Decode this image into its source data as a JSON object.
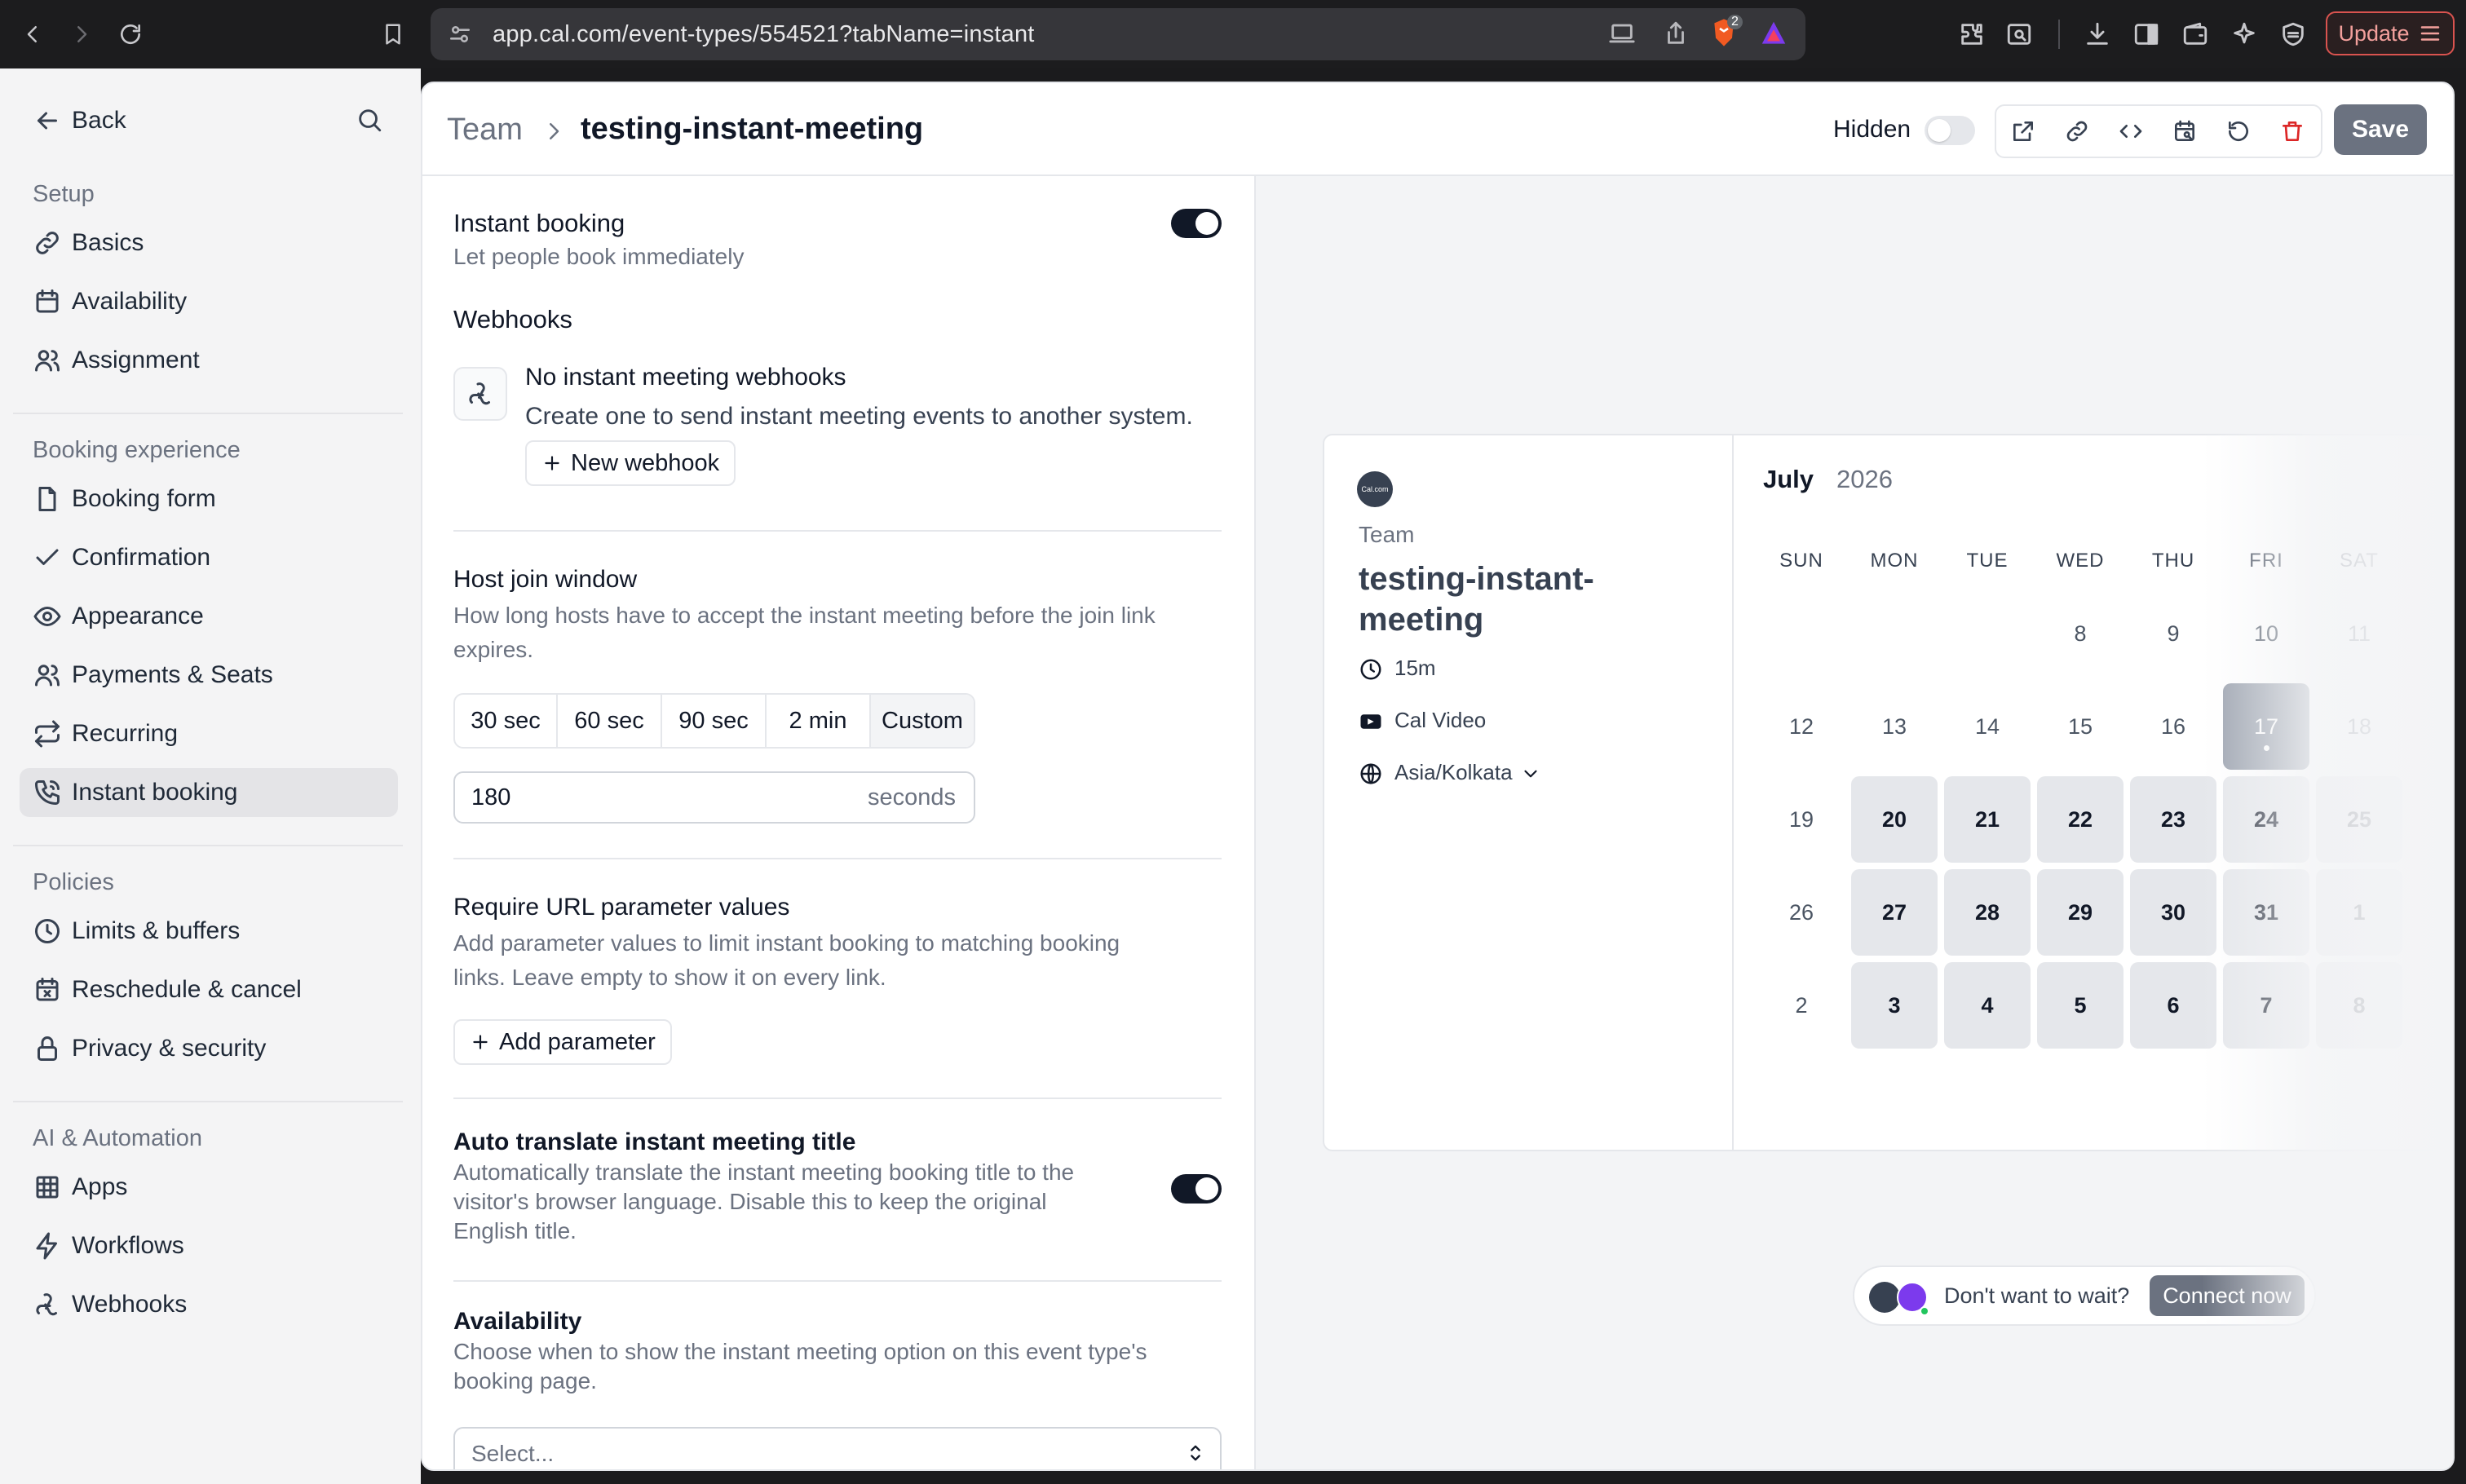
{
  "browser": {
    "url": "app.cal.com/event-types/554521?tabName=instant",
    "shield_badge": "2",
    "update_label": "Update"
  },
  "sidebar": {
    "back_label": "Back",
    "sections": [
      {
        "heading": "Setup",
        "items": [
          "Basics",
          "Availability",
          "Assignment"
        ]
      },
      {
        "heading": "Booking experience",
        "items": [
          "Booking form",
          "Confirmation",
          "Appearance",
          "Payments & Seats",
          "Recurring",
          "Instant booking"
        ]
      },
      {
        "heading": "Policies",
        "items": [
          "Limits & buffers",
          "Reschedule & cancel",
          "Privacy & security"
        ]
      },
      {
        "heading": "AI & Automation",
        "items": [
          "Apps",
          "Workflows",
          "Webhooks"
        ]
      }
    ],
    "active_item": "Instant booking"
  },
  "header": {
    "breadcrumb_team": "Team",
    "title": "testing-instant-meeting",
    "hidden_label": "Hidden",
    "hidden_toggle": false,
    "save_label": "Save"
  },
  "settings": {
    "instant_booking": {
      "title": "Instant booking",
      "description": "Let people book immediately",
      "enabled": true
    },
    "webhooks": {
      "heading": "Webhooks",
      "empty_title": "No instant meeting webhooks",
      "empty_description": "Create one to send instant meeting events to another system.",
      "new_button": "New webhook"
    },
    "host_join_window": {
      "title": "Host join window",
      "description_line1": "How long hosts have to accept the instant meeting before the join link",
      "description_line2": "expires.",
      "options": [
        "30 sec",
        "60 sec",
        "90 sec",
        "2 min",
        "Custom"
      ],
      "selected": "Custom",
      "value": "180",
      "unit": "seconds"
    },
    "url_params": {
      "title": "Require URL parameter values",
      "description_line1": "Add parameter values to limit instant booking to matching booking",
      "description_line2": "links. Leave empty to show it on every link.",
      "add_button": "Add parameter"
    },
    "auto_translate": {
      "title": "Auto translate instant meeting title",
      "description_line1": "Automatically translate the instant meeting booking title to the",
      "description_line2": "visitor's browser language. Disable this to keep the original",
      "description_line3": "English title.",
      "enabled": true
    },
    "availability": {
      "title": "Availability",
      "description_line1": "Choose when to show the instant meeting option on this event type's",
      "description_line2": "booking page.",
      "select_placeholder": "Select..."
    }
  },
  "preview": {
    "brand": "Cal.com",
    "team": "Team",
    "event_title_line1": "testing-instant-",
    "event_title_line2": "meeting",
    "duration": "15m",
    "location": "Cal Video",
    "timezone": "Asia/Kolkata",
    "month": "July",
    "year": "2026",
    "weekdays": [
      "SUN",
      "MON",
      "TUE",
      "WED",
      "THU",
      "FRI",
      "SAT"
    ],
    "weeks": [
      [
        null,
        null,
        null,
        "8",
        "9",
        "10",
        "11"
      ],
      [
        "12",
        "13",
        "14",
        "15",
        "16",
        "17",
        "18"
      ],
      [
        "19",
        "20",
        "21",
        "22",
        "23",
        "24",
        "25"
      ],
      [
        "26",
        "27",
        "28",
        "29",
        "30",
        "31",
        "1"
      ],
      [
        "2",
        "3",
        "4",
        "5",
        "6",
        "7",
        "8"
      ]
    ],
    "today": "17",
    "available_days": [
      "20",
      "21",
      "22",
      "23",
      "24",
      "25",
      "27",
      "28",
      "29",
      "30",
      "31",
      "1",
      "3",
      "4",
      "5",
      "6",
      "7",
      "8"
    ],
    "connect_prompt": "Don't want to wait?",
    "connect_button": "Connect now"
  }
}
